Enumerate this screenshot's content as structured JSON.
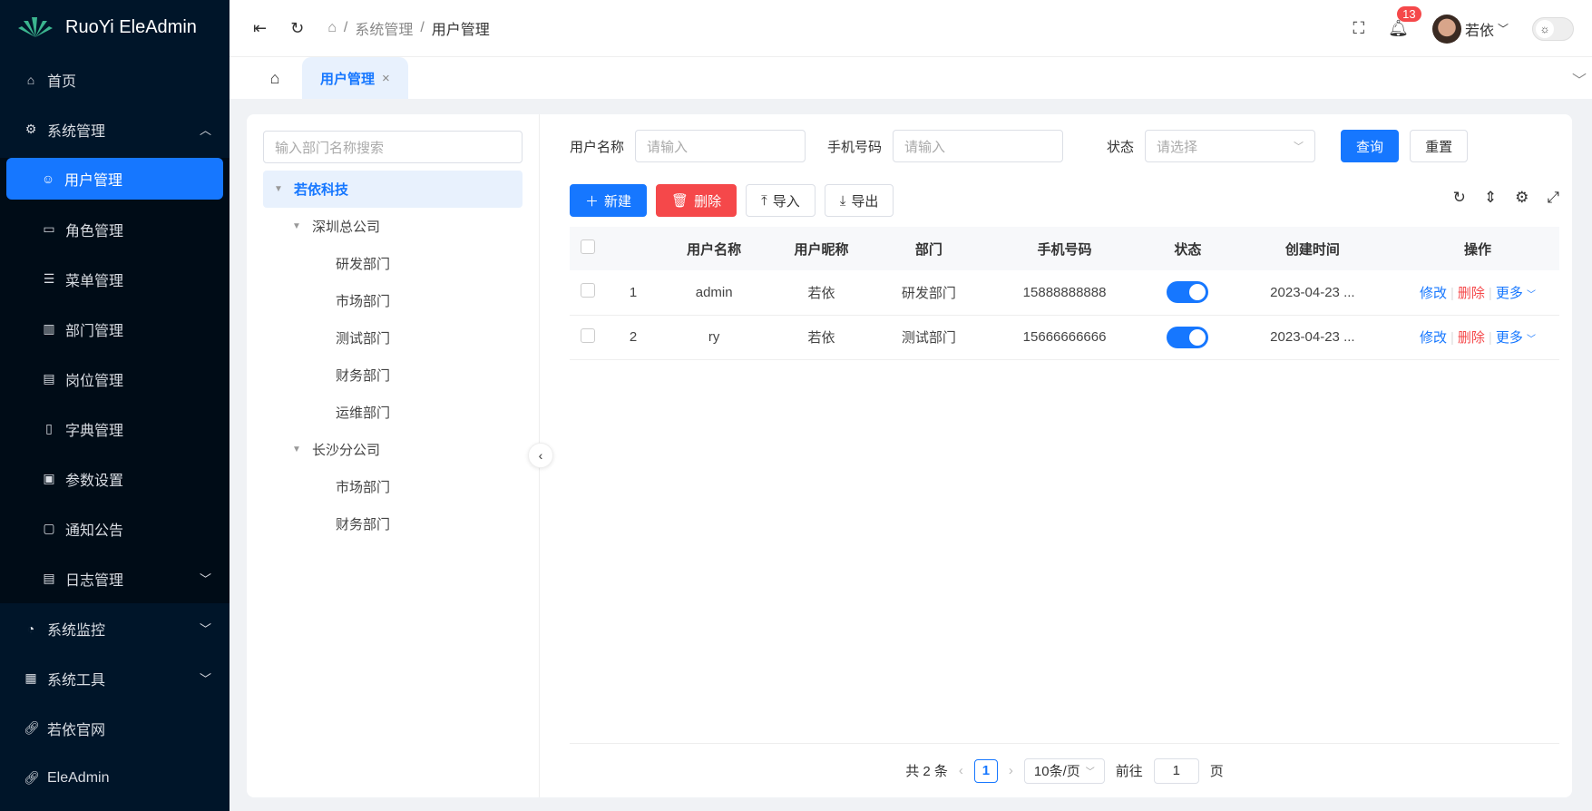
{
  "app": {
    "title": "RuoYi EleAdmin"
  },
  "sidebar": {
    "items": [
      {
        "label": "首页",
        "icon": "home-icon"
      },
      {
        "label": "系统管理",
        "icon": "gear-icon",
        "expanded": true
      },
      {
        "label": "用户管理",
        "icon": "user-icon",
        "active": true
      },
      {
        "label": "角色管理",
        "icon": "id-card-icon"
      },
      {
        "label": "菜单管理",
        "icon": "sliders-icon"
      },
      {
        "label": "部门管理",
        "icon": "building-icon"
      },
      {
        "label": "岗位管理",
        "icon": "briefcase-icon"
      },
      {
        "label": "字典管理",
        "icon": "book-icon"
      },
      {
        "label": "参数设置",
        "icon": "settings-card-icon"
      },
      {
        "label": "通知公告",
        "icon": "message-icon"
      },
      {
        "label": "日志管理",
        "icon": "log-icon"
      },
      {
        "label": "系统监控",
        "icon": "dashboard-icon"
      },
      {
        "label": "系统工具",
        "icon": "toolbox-icon"
      },
      {
        "label": "若依官网",
        "icon": "link-icon"
      },
      {
        "label": "EleAdmin",
        "icon": "link-icon"
      }
    ]
  },
  "header": {
    "breadcrumb": [
      "系统管理",
      "用户管理"
    ],
    "notifications": "13",
    "user": "若依"
  },
  "tabs": [
    {
      "label": "用户管理"
    }
  ],
  "tree": {
    "placeholder": "输入部门名称搜索",
    "nodes": [
      {
        "label": "若依科技",
        "level": 0,
        "selected": true
      },
      {
        "label": "深圳总公司",
        "level": 1
      },
      {
        "label": "研发部门",
        "level": 2
      },
      {
        "label": "市场部门",
        "level": 2
      },
      {
        "label": "测试部门",
        "level": 2
      },
      {
        "label": "财务部门",
        "level": 2
      },
      {
        "label": "运维部门",
        "level": 2
      },
      {
        "label": "长沙分公司",
        "level": 1
      },
      {
        "label": "市场部门",
        "level": 2
      },
      {
        "label": "财务部门",
        "level": 2
      }
    ]
  },
  "search": {
    "username_label": "用户名称",
    "username_placeholder": "请输入",
    "phone_label": "手机号码",
    "phone_placeholder": "请输入",
    "status_label": "状态",
    "status_placeholder": "请选择",
    "query": "查询",
    "reset": "重置"
  },
  "toolbar": {
    "add": "新建",
    "delete": "删除",
    "import": "导入",
    "export": "导出"
  },
  "table": {
    "headers": [
      "用户名称",
      "用户昵称",
      "部门",
      "手机号码",
      "状态",
      "创建时间",
      "操作"
    ],
    "rows": [
      {
        "no": "1",
        "username": "admin",
        "nickname": "若依",
        "dept": "研发部门",
        "phone": "15888888888",
        "status": true,
        "created": "2023-04-23 ..."
      },
      {
        "no": "2",
        "username": "ry",
        "nickname": "若依",
        "dept": "测试部门",
        "phone": "15666666666",
        "status": true,
        "created": "2023-04-23 ..."
      }
    ],
    "actions": {
      "edit": "修改",
      "delete": "删除",
      "more": "更多"
    }
  },
  "pagination": {
    "total": "共 2 条",
    "page": "1",
    "size": "10条/页",
    "goto": "前往",
    "goto_value": "1",
    "page_unit": "页"
  }
}
